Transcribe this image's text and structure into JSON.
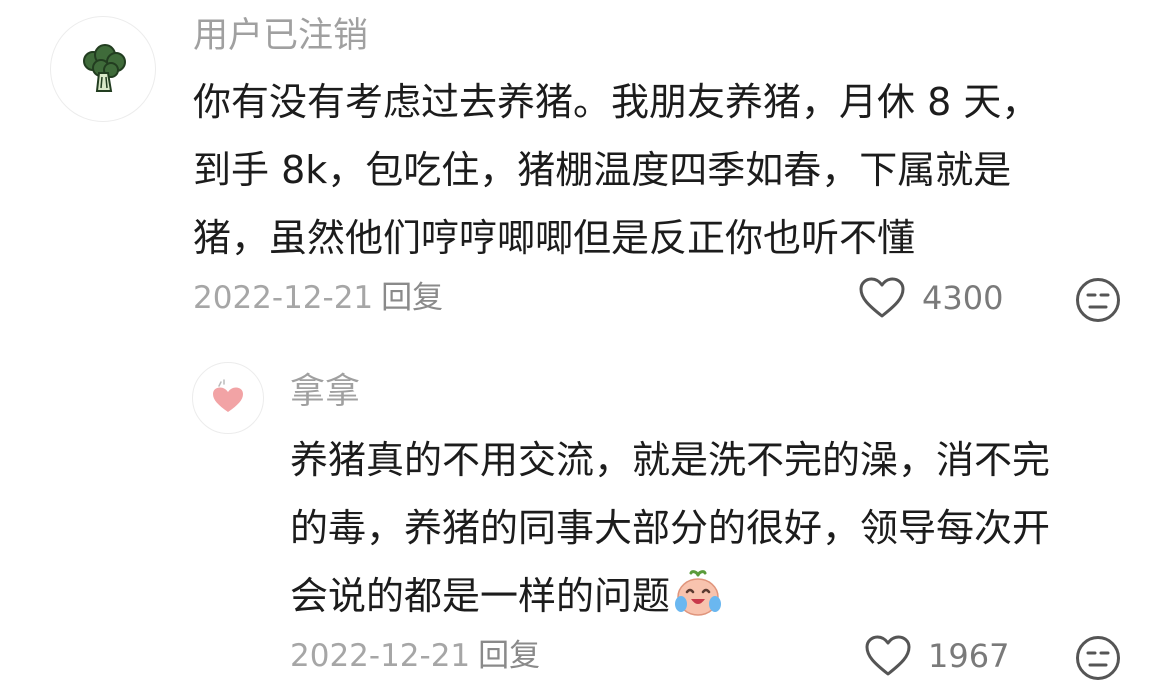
{
  "comments": [
    {
      "username": "用户已注销",
      "avatar_icon": "broccoli-icon",
      "lines": [
        "你有没有考虑过去养猪。我朋友养猪，月休 8 天，",
        "到手 8k，包吃住，猪棚温度四季如春，下属就是",
        "猪，虽然他们哼哼唧唧但是反正你也听不懂"
      ],
      "date": "2022-12-21",
      "reply_label": "回复",
      "likes": "4300",
      "dislike_icon": "meh-face-icon"
    },
    {
      "username": "拿拿",
      "avatar_icon": "pink-heart-icon",
      "lines": [
        "养猪真的不用交流，就是洗不完的澡，消不完",
        "的毒，养猪的同事大部分的很好，领导每次开",
        "会说的都是一样的问题"
      ],
      "emoji": "crying-laughing-emoji",
      "date": "2022-12-21",
      "reply_label": "回复",
      "likes": "1967",
      "dislike_icon": "meh-face-icon"
    }
  ],
  "colors": {
    "username": "#a0a0a0",
    "text": "#1c1c1c",
    "meta": "#a6a6a6",
    "icon": "#555555"
  }
}
